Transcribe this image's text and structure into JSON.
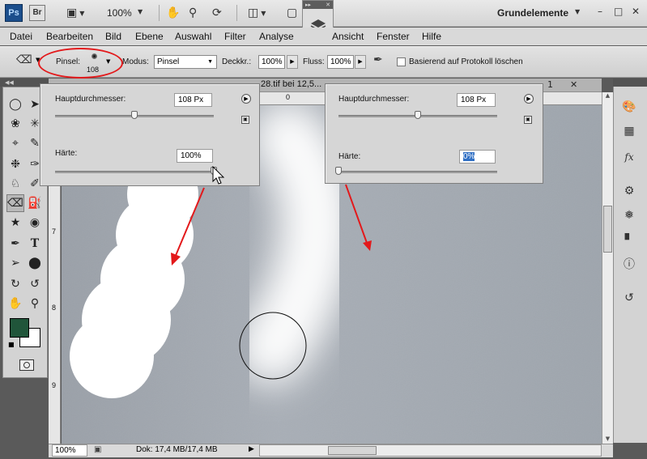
{
  "app": {
    "logo": "Ps",
    "bridge": "Br",
    "zoom": "100%",
    "workspace": "Grundelemente"
  },
  "window_controls": {
    "minimize": "–",
    "restore": "□",
    "close": "✕"
  },
  "menu": [
    "Datei",
    "Bearbeiten",
    "Bild",
    "Ebene",
    "Auswahl",
    "Filter",
    "Analyse",
    "Ansicht",
    "Fenster",
    "Hilfe"
  ],
  "options": {
    "brush_label": "Pinsel:",
    "brush_size": "108",
    "mode_label": "Modus:",
    "mode_value": "Pinsel",
    "opacity_label": "Deckkr.:",
    "opacity_value": "100%",
    "flow_label": "Fluss:",
    "flow_value": "100%",
    "history_label": "Basierend auf Protokoll löschen"
  },
  "document": {
    "tab_title": "28.tif bei 12,5...",
    "ruler_top": [
      "0"
    ],
    "ruler_left": [
      "7",
      "8",
      "9"
    ],
    "status_zoom": "100%",
    "status_doc": "Dok: 17,4 MB/17,4 MB"
  },
  "popup_left": {
    "diameter_label": "Hauptdurchmesser:",
    "diameter_value": "108 Px",
    "hardness_label": "Härte:",
    "hardness_value": "100%",
    "diameter_level": 0.5,
    "hardness_level": 1.0
  },
  "popup_right": {
    "diameter_label": "Hauptdurchmesser:",
    "diameter_value": "108 Px",
    "hardness_label": "Härte:",
    "hardness_value": "0%",
    "diameter_level": 0.5,
    "hardness_level": 0.0
  },
  "colors": {
    "foreground": "#20553a",
    "background": "#ffffff",
    "annotation": "#e3191b"
  },
  "icons": {
    "tools": [
      "marquee-icon",
      "move-icon",
      "lasso-icon",
      "magic-wand-icon",
      "crop-icon",
      "eyedropper-icon",
      "healing-brush-icon",
      "brush-icon",
      "clone-stamp-icon",
      "history-brush-icon",
      "eraser-icon",
      "paint-bucket-icon",
      "dodge-icon",
      "pen-icon",
      "type-icon",
      "path-selection-icon",
      "shape-icon",
      "3d-rotate-icon",
      "3d-orbit-icon",
      "hand-icon",
      "zoom-icon"
    ],
    "dock": [
      "color-panel-icon",
      "swatches-icon",
      "styles-icon",
      "adjustments-icon",
      "masks-icon",
      "histogram-icon",
      "info-icon",
      "history-panel-icon"
    ]
  }
}
